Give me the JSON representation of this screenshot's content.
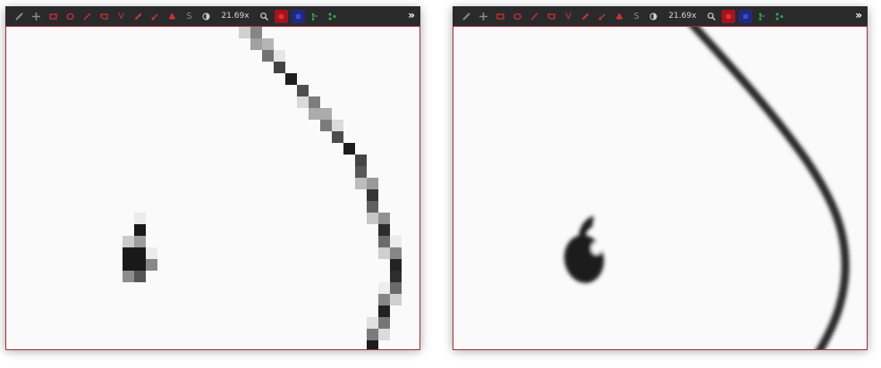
{
  "viewers": [
    {
      "rendering": "pixelated",
      "toolbar": {
        "tools": [
          "ruler-icon",
          "pan-icon",
          "rectangle-icon",
          "ellipse-icon",
          "line-icon",
          "polygon-icon",
          "vector-icon",
          "pencil-icon",
          "brush-icon",
          "fill-icon",
          "s-label",
          "contrast-icon"
        ],
        "vector_label": "V",
        "s_label": "S",
        "zoom_level": "21.69x",
        "more_label": "»"
      }
    },
    {
      "rendering": "smooth",
      "toolbar": {
        "tools": [
          "ruler-icon",
          "pan-icon",
          "rectangle-icon",
          "ellipse-icon",
          "line-icon",
          "polygon-icon",
          "vector-icon",
          "pencil-icon",
          "brush-icon",
          "fill-icon",
          "s-label",
          "contrast-icon"
        ],
        "vector_label": "V",
        "s_label": "S",
        "zoom_level": "21.69x",
        "more_label": "»"
      }
    }
  ],
  "colors": {
    "toolbar_bg": "#2a2a2c",
    "tool_red": "#cc3333",
    "active_red": "#a3141c",
    "active_blue": "#1f2a80",
    "green_tools": "#2fb24a",
    "canvas_border": "#a0303a",
    "ink": "#1a1a1a"
  }
}
